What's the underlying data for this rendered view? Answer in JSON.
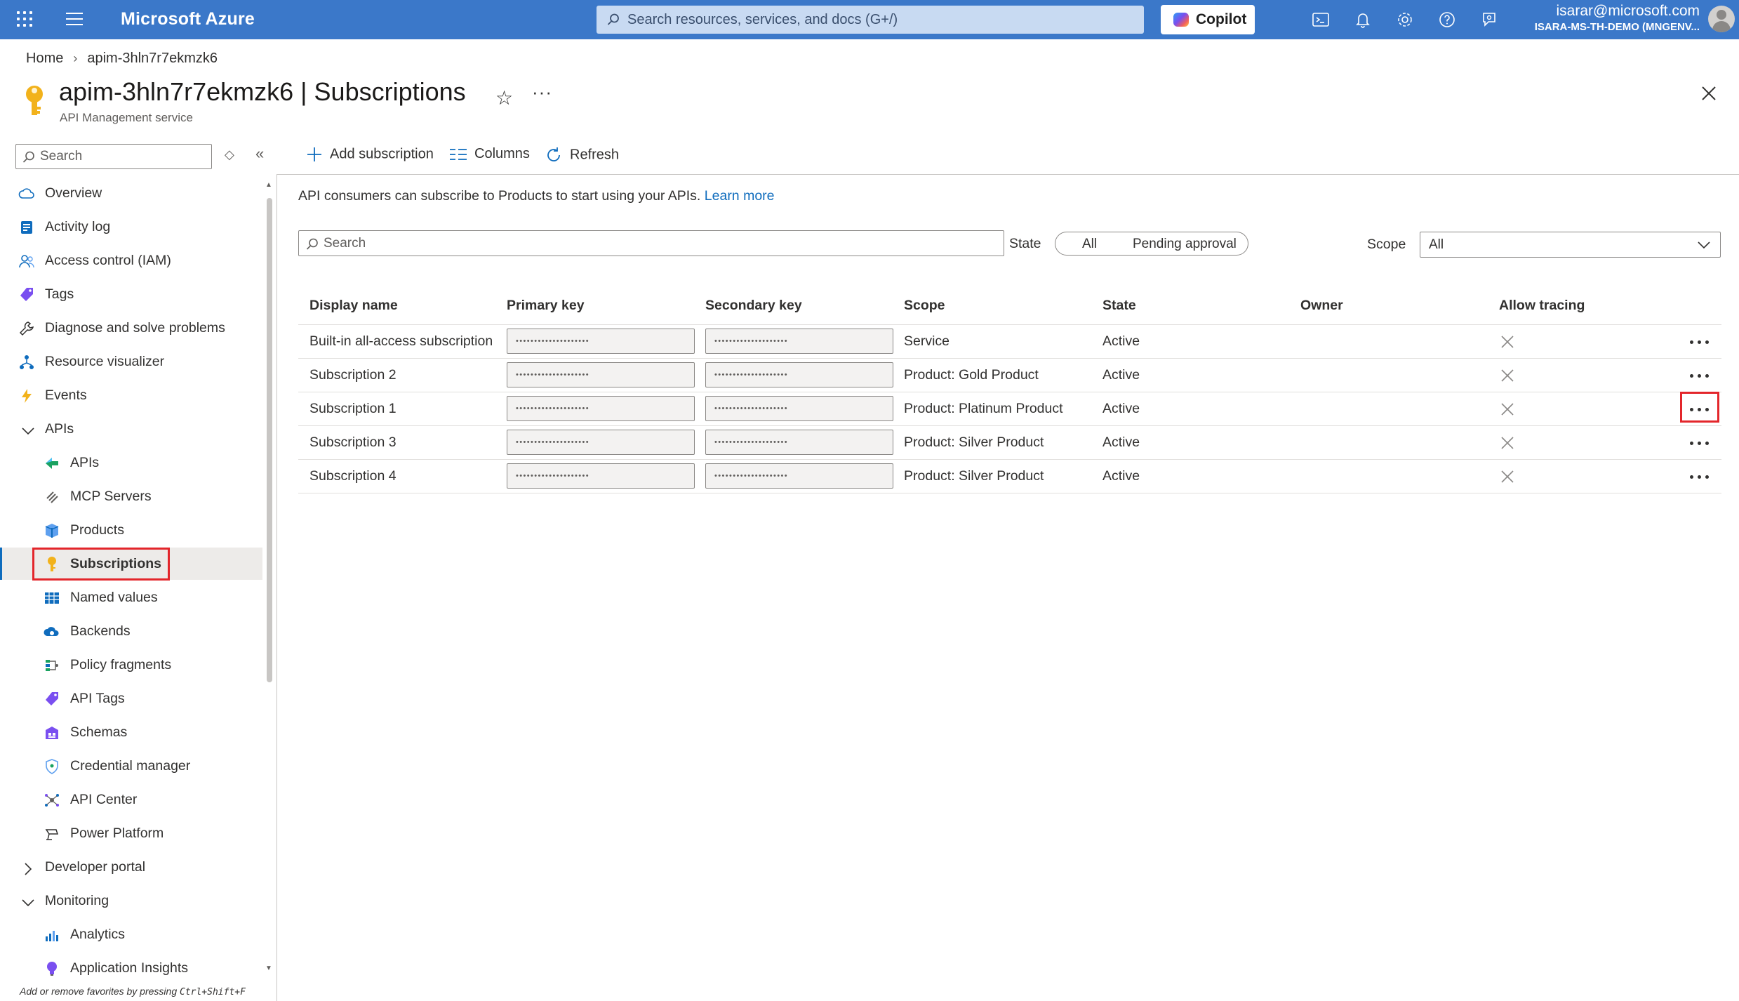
{
  "topbar": {
    "brand": "Microsoft Azure",
    "search_placeholder": "Search resources, services, and docs (G+/)",
    "copilot_label": "Copilot",
    "user_email": "isarar@microsoft.com",
    "user_tenant": "ISARA-MS-TH-DEMO (MNGENV..."
  },
  "breadcrumb": {
    "home": "Home",
    "current": "apim-3hln7r7ekmzk6"
  },
  "header": {
    "resource_name": "apim-3hln7r7ekmzk6",
    "separator": "|",
    "page": "Subscriptions",
    "subtitle": "API Management service"
  },
  "nav": {
    "search_placeholder": "Search",
    "items": [
      {
        "label": "Overview",
        "icon": "cloud-icon"
      },
      {
        "label": "Activity log",
        "icon": "activity-log-icon"
      },
      {
        "label": "Access control (IAM)",
        "icon": "people-icon"
      },
      {
        "label": "Tags",
        "icon": "tag-icon"
      },
      {
        "label": "Diagnose and solve problems",
        "icon": "wrench-icon"
      },
      {
        "label": "Resource visualizer",
        "icon": "network-icon"
      },
      {
        "label": "Events",
        "icon": "lightning-icon"
      },
      {
        "label": "APIs",
        "icon": "chevron-down-icon"
      },
      {
        "label": "APIs",
        "icon": "api-icon"
      },
      {
        "label": "MCP Servers",
        "icon": "mcp-icon"
      },
      {
        "label": "Products",
        "icon": "product-box-icon"
      },
      {
        "label": "Subscriptions",
        "icon": "key-icon"
      },
      {
        "label": "Named values",
        "icon": "table-icon"
      },
      {
        "label": "Backends",
        "icon": "cloud-gear-icon"
      },
      {
        "label": "Policy fragments",
        "icon": "policy-icon"
      },
      {
        "label": "API Tags",
        "icon": "tag-icon"
      },
      {
        "label": "Schemas",
        "icon": "schema-icon"
      },
      {
        "label": "Credential manager",
        "icon": "shield-icon"
      },
      {
        "label": "API Center",
        "icon": "api-center-icon"
      },
      {
        "label": "Power Platform",
        "icon": "power-platform-icon"
      },
      {
        "label": "Developer portal",
        "icon": "chevron-right-icon"
      },
      {
        "label": "Monitoring",
        "icon": "chevron-down-icon"
      },
      {
        "label": "Analytics",
        "icon": "chart-icon"
      },
      {
        "label": "Application Insights",
        "icon": "bulb-icon"
      }
    ],
    "hint_prefix": "Add or remove favorites by pressing",
    "hint_shortcut": "Ctrl+Shift+F"
  },
  "toolbar": {
    "add": "Add subscription",
    "columns": "Columns",
    "refresh": "Refresh"
  },
  "content": {
    "info": "API consumers can subscribe to Products to start using your APIs.",
    "learn_more": "Learn more",
    "search_placeholder": "Search",
    "state_label": "State",
    "state_options": [
      "All",
      "Pending approval"
    ],
    "scope_label": "Scope",
    "scope_value": "All"
  },
  "table": {
    "headers": [
      "Display name",
      "Primary key",
      "Secondary key",
      "Scope",
      "State",
      "Owner",
      "Allow tracing"
    ],
    "masked_key": "••••••••••••••••••••",
    "rows": [
      {
        "name": "Built-in all-access subscription",
        "scope": "Service",
        "state": "Active",
        "owner": ""
      },
      {
        "name": "Subscription 2",
        "scope": "Product: Gold Product",
        "state": "Active",
        "owner": ""
      },
      {
        "name": "Subscription 1",
        "scope": "Product: Platinum Product",
        "state": "Active",
        "owner": ""
      },
      {
        "name": "Subscription 3",
        "scope": "Product: Silver Product",
        "state": "Active",
        "owner": ""
      },
      {
        "name": "Subscription 4",
        "scope": "Product: Silver Product",
        "state": "Active",
        "owner": ""
      }
    ]
  },
  "colors": {
    "topbar": "#3b78c9",
    "accent": "#0f6cbd",
    "highlight": "#e3262b"
  }
}
